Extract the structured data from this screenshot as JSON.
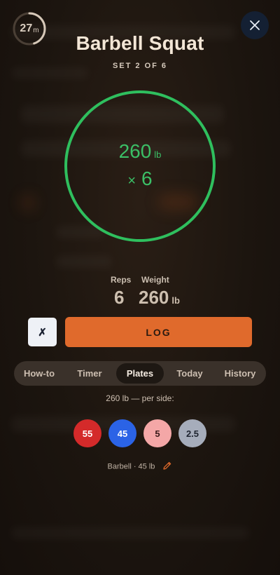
{
  "timer": {
    "value": "27",
    "unit": "m",
    "progress": 0.45
  },
  "exercise": {
    "title": "Barbell Squat",
    "set_label": "SET 2 OF 6"
  },
  "ring": {
    "weight": "260",
    "unit": "lb",
    "times_symbol": "×",
    "reps": "6"
  },
  "stats": {
    "reps_label": "Reps",
    "weight_label": "Weight",
    "reps_value": "6",
    "weight_value": "260",
    "weight_unit": "lb"
  },
  "actions": {
    "cancel_symbol": "✗",
    "log_label": "LOG"
  },
  "tabs": [
    {
      "label": "How-to",
      "active": false
    },
    {
      "label": "Timer",
      "active": false
    },
    {
      "label": "Plates",
      "active": true
    },
    {
      "label": "Today",
      "active": false
    },
    {
      "label": "History",
      "active": false
    }
  ],
  "plates": {
    "heading": "260 lb — per side:",
    "items": [
      {
        "label": "55",
        "color": "#d42a2a",
        "text_color": "#ffffff"
      },
      {
        "label": "45",
        "color": "#2b63e6",
        "text_color": "#ffffff"
      },
      {
        "label": "5",
        "color": "#f4a7a7",
        "text_color": "#3a1a1a"
      },
      {
        "label": "2.5",
        "color": "#a6adbb",
        "text_color": "#1e2430"
      }
    ],
    "barbell": "Barbell · 45 lb"
  },
  "colors": {
    "accent": "#e06a2c",
    "ring": "#2fbf5e",
    "background": "#1b140f"
  },
  "icons": {
    "close": "close-icon",
    "edit": "pencil-icon"
  }
}
